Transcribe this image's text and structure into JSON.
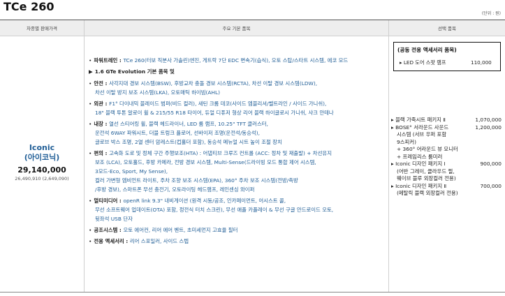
{
  "page": {
    "title": "TCe 260",
    "unit": "(단위 : 원)"
  },
  "header": {
    "col1": "차종별 판매가격",
    "col2": "주요 기본 품목",
    "col3": "선택 품목"
  },
  "trim": {
    "name": "Iconic",
    "name_kr": "(아이코닉)",
    "price": "29,140,000",
    "price_detail": "26,490,910 (2,649,090)"
  },
  "specs": [
    {
      "label": "파워트레인 : ",
      "lines": [
        "TCe 260(터보 직분사 가솔린)엔진, 게트락 7단 EDC 변속기(습식), 오토 스탑/스타트 시스템, 에코 모드"
      ]
    },
    {
      "label": "1.6 GTe Evolution 기본 품목 및",
      "lines": []
    },
    {
      "label": "안전 : ",
      "lines": [
        "사각지대 경보 시스템(BSW), 후방교차 충돌 경보 시스템(RCTA), 차선 이탈 경보 시스템(LDW),",
        "차선 이탈 방지 보조 시스템(LKA), 오토매틱 하이빔(AHL)"
      ]
    },
    {
      "label": "외관 : ",
      "lines": [
        "F1° 다이내믹 블레이드 범퍼(비드 컬러), 새틴 크롬 데코(사이드 엠블리셔/벨트라인 / 사이드 가니쉬),",
        "18\" 블랙 투톤 알로이 휠 & 215/55 R18 타이어, 듀얼 디퓨저 형상 리어 블랙 하이글로시 가니쉬, 샤크 안테나"
      ]
    },
    {
      "label": "내장 : ",
      "lines": [
        "열선 스티어링 휠, 블랙 헤드라이너, LED 룸 램프, 10.25\" TFT 클러스터,",
        "운전석 6WAY 파워시트, 더블 트렁크 플로어, 선바이저 조명(운전석/동승석),",
        "글로브 박스 조명, 2열 센터 암레스트(컵홀더 포함), 동승석 메뉴얼 시트 높이 조절 장치"
      ]
    },
    {
      "label": "편의 : ",
      "lines": [
        "고속화 도로 및 정체 구간 주행보조(HTA) : 어댑티브 크루즈 컨트롤 (ACC: 정차 및 재출발) + 차선유지",
        "보조 (LCA), 오토홀드, 후방 카메라, 전방 경보 시스템, Multi-Sense(드라이빙 모드 통합 제어 시스템,",
        "3모드-Eco, Sport, My Sense),",
        "컬러 가변형 엠비언트 라이트, 주차 조향 보조 시스템(EPA), 360° 주차 보조 시스템(전방/측방",
        "/후방 경보), 스마트폰 무선 충전기, 오토라이팅 헤드램프, 레인센싱 와이퍼"
      ]
    },
    {
      "label": "멀티미디어 : ",
      "lines": [
        "openR link 9.3\" 내비게이션 (원격 시동/공조, 인카페이먼트, 어시스트 콜,",
        "무선 소프트웨어 업데이트(OTA) 포함, 정전식 터치 스크린), 무선 애플 카플레이 & 무선 구글 안드로이드 오토,",
        "뒷좌석 USB 단자"
      ]
    },
    {
      "label": "공조시스템 : ",
      "lines": [
        "오토 에어컨, 리어 에어 벤트, 초미세먼지 고효율 필터"
      ]
    },
    {
      "label": "전용 액세서리 : ",
      "lines": [
        "리어 스포일러, 사이드 스텝"
      ]
    }
  ],
  "accessory_box": {
    "title": "(공동 전용 액세서리 품목)",
    "item": "LED 도어 스팟 램프",
    "price": "110,000"
  },
  "options": [
    {
      "name": "블랙 가죽시트 패키지 Ⅱ",
      "price": "1,070,000",
      "sub": []
    },
    {
      "name": "BOSE° 서라운드 사운드",
      "price": "1,200,000",
      "sub": [
        "시스템 (서브 우퍼 포함",
        "9스피커)",
        "+ 360° 어라운드 뷰 모니터",
        "+ 프레임리스 룸미러"
      ]
    },
    {
      "name": "Iconic 디자인 패키지 Ⅰ",
      "price": "900,000",
      "sub": [
        "(어반 그레이, 클라우드 펄,",
        "웨이브 블루  외장컬러 전용)"
      ]
    },
    {
      "name": "Iconic 디자인 패키지 Ⅱ",
      "price": "700,000",
      "sub": [
        "(메탈릭 블랙 외장컬러 전용)"
      ]
    }
  ]
}
